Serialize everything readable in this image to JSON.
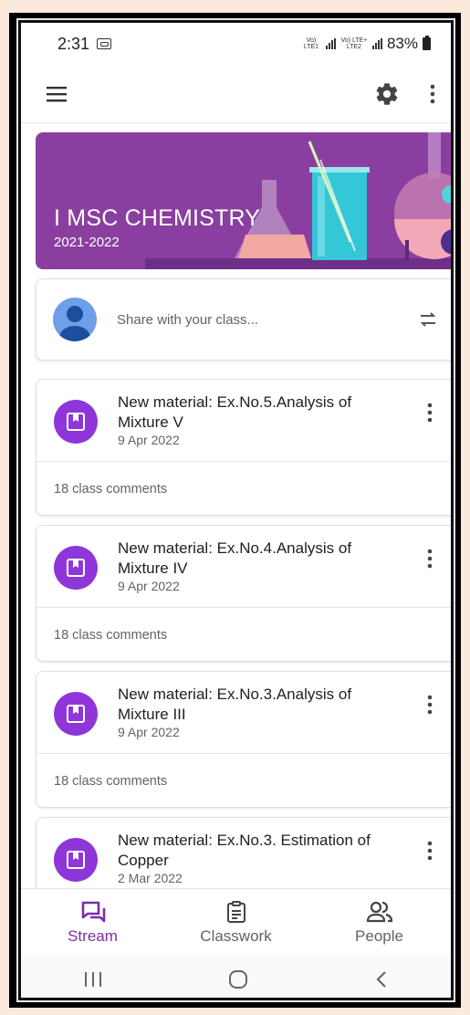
{
  "status_bar": {
    "time": "2:31",
    "sim1": "Vo) LTE1",
    "sim2": "Vo) LTE+ LTE2",
    "battery": "83%"
  },
  "app_bar": {
    "menu_icon": "hamburger-menu-icon",
    "settings_icon": "gear-icon",
    "more_icon": "more-vert-icon"
  },
  "banner": {
    "title": "I MSC CHEMISTRY",
    "subtitle": "2021-2022",
    "color": "#8a3fa0"
  },
  "share": {
    "placeholder": "Share with your class...",
    "repost_icon": "repost-icon"
  },
  "posts": [
    {
      "title": "New material: Ex.No.5.Analysis of Mixture V",
      "date": "9 Apr 2022",
      "comments": "18 class comments"
    },
    {
      "title": "New material: Ex.No.4.Analysis of Mixture IV",
      "date": "9 Apr 2022",
      "comments": "18 class comments"
    },
    {
      "title": "New material: Ex.No.3.Analysis of Mixture III",
      "date": "9 Apr 2022",
      "comments": "18 class comments"
    },
    {
      "title": "New material: Ex.No.3. Estimation of Copper",
      "date": "2 Mar 2022",
      "comments": ""
    }
  ],
  "bottom_nav": {
    "stream": "Stream",
    "classwork": "Classwork",
    "people": "People",
    "active_color": "#7b2fa6"
  },
  "accent_color": "#8e36d9"
}
